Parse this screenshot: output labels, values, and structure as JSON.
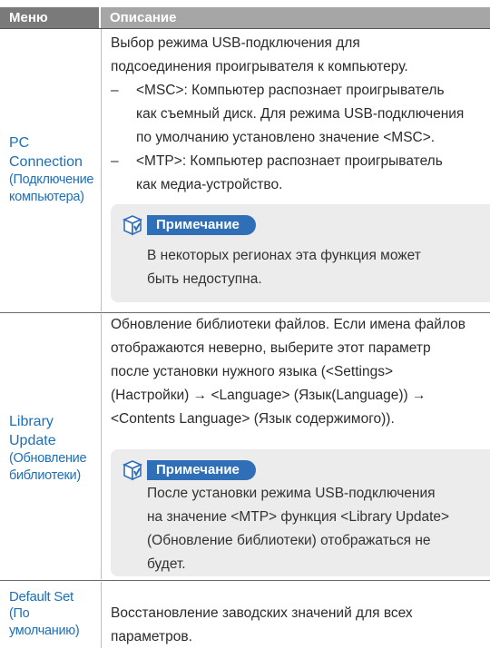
{
  "header": {
    "col_menu": "Меню",
    "col_desc": "Описание"
  },
  "rows": [
    {
      "menu_lines": [
        "PC",
        "Connection"
      ],
      "menu_sub_lines": [
        "(Подключение",
        "компьютера)"
      ],
      "desc_lines": [
        "Выбор режима USB-подключения для",
        "подсоединения проигрывателя к компьютеру."
      ],
      "bullets": [
        {
          "dash": "–",
          "lines": [
            "<MSC>: Компьютер распознает проигрыватель",
            "как съемный диск. Для режима USB-подключения",
            "по умолчанию установлено значение <MSC>."
          ]
        },
        {
          "dash": "–",
          "lines": [
            "<MTP>: Компьютер распознает проигрыватель",
            "как медиа-устройство."
          ]
        }
      ],
      "note": {
        "label": "Примечание",
        "lines": [
          "В некоторых регионах эта функция может",
          "быть недоступна."
        ]
      }
    },
    {
      "menu_lines": [
        "Library",
        "Update"
      ],
      "menu_sub_lines": [
        "(Обновление",
        "библиотеки)"
      ],
      "desc_lines": [
        "Обновление библиотеки файлов. Если имена файлов",
        "отображаются неверно, выберите этот параметр",
        "после установки нужного языка (<Settings>",
        "(Настройки) → <Language> (Язык(Language)) →",
        "<Contents Language> (Язык содержимого))."
      ],
      "note": {
        "label": "Примечание",
        "lines": [
          "После установки режима USB-подключения",
          "на значение <MTP> функция <Library Update>",
          "(Обновление библиотеки) отображаться не",
          "будет."
        ]
      }
    },
    {
      "menu_lines": [
        "Default Set"
      ],
      "menu_sub_lines": [
        "(По",
        "умолчанию)"
      ],
      "desc_lines": [
        "Восстановление заводских значений для всех",
        "параметров."
      ]
    }
  ],
  "colors": {
    "header_dark": "#7a7a7a",
    "header_light": "#a6a6a6",
    "menu_blue": "#1d6fb7",
    "note_blue": "#2f6fb8",
    "note_bg": "#ececec"
  },
  "icons": [
    "note-icon"
  ]
}
